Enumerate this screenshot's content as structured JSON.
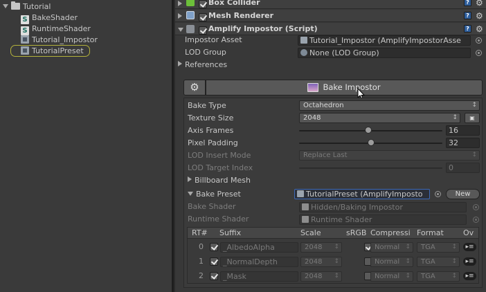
{
  "project": {
    "folder": "Tutorial",
    "items": [
      {
        "label": "BakeShader",
        "icon": "shader-icon"
      },
      {
        "label": "RuntimeShader",
        "icon": "shader-icon"
      },
      {
        "label": "Tutorial_Impostor",
        "icon": "asset-icon"
      },
      {
        "label": "TutorialPreset",
        "icon": "asset-icon",
        "selected": true
      }
    ]
  },
  "components": {
    "box_collider": "Box Collider",
    "mesh_renderer": "Mesh Renderer",
    "amplify": "Amplify Impostor (Script)"
  },
  "impostor": {
    "asset_label": "Impostor Asset",
    "asset_value": "Tutorial_Impostor (AmplifyImpostorAsse",
    "lod_group_label": "LOD Group",
    "lod_group_value": "None (LOD Group)",
    "references_label": "References",
    "bake_button": "Bake Impostor"
  },
  "settings": {
    "bake_type_label": "Bake Type",
    "bake_type_value": "Octahedron",
    "texture_size_label": "Texture Size",
    "texture_size_value": "2048",
    "axis_frames_label": "Axis Frames",
    "axis_frames_value": "16",
    "axis_frames_fraction": 0.48,
    "pixel_padding_label": "Pixel Padding",
    "pixel_padding_value": "32",
    "pixel_padding_fraction": 0.5,
    "lod_insert_label": "LOD Insert Mode",
    "lod_insert_value": "Replace Last",
    "lod_target_label": "LOD Target Index",
    "lod_target_value": "0",
    "billboard_label": "Billboard Mesh",
    "bake_preset_label": "Bake Preset",
    "bake_preset_value": "TutorialPreset (AmplifyImposto",
    "new_button": "New",
    "bake_shader_label": "Bake Shader",
    "bake_shader_value": "Hidden/Baking Impostor",
    "runtime_shader_label": "Runtime Shader",
    "runtime_shader_value": "Runtime Shader"
  },
  "table": {
    "headers": {
      "rt": "RT#",
      "suffix": "Suffix",
      "scale": "Scale",
      "srgb": "sRGB",
      "compression": "Compressi",
      "format": "Format",
      "ov": "Ov"
    },
    "rows": [
      {
        "rt": "0",
        "suffix": "_AlbedoAlpha",
        "scale": "2048",
        "srgb": true,
        "compression": "Normal",
        "format": "TGA"
      },
      {
        "rt": "1",
        "suffix": "_NormalDepth",
        "scale": "2048",
        "srgb": false,
        "compression": "Normal",
        "format": "TGA"
      },
      {
        "rt": "2",
        "suffix": "_Mask",
        "scale": "2048",
        "srgb": false,
        "compression": "Normal",
        "format": "TGA"
      }
    ]
  },
  "icons": {
    "help": "?",
    "gear": "⚙",
    "lock": "▣",
    "overflow": "▸≡"
  },
  "colors": {
    "selection_outline": "#b4b23c",
    "preset_highlight": "#3d6ab8"
  }
}
